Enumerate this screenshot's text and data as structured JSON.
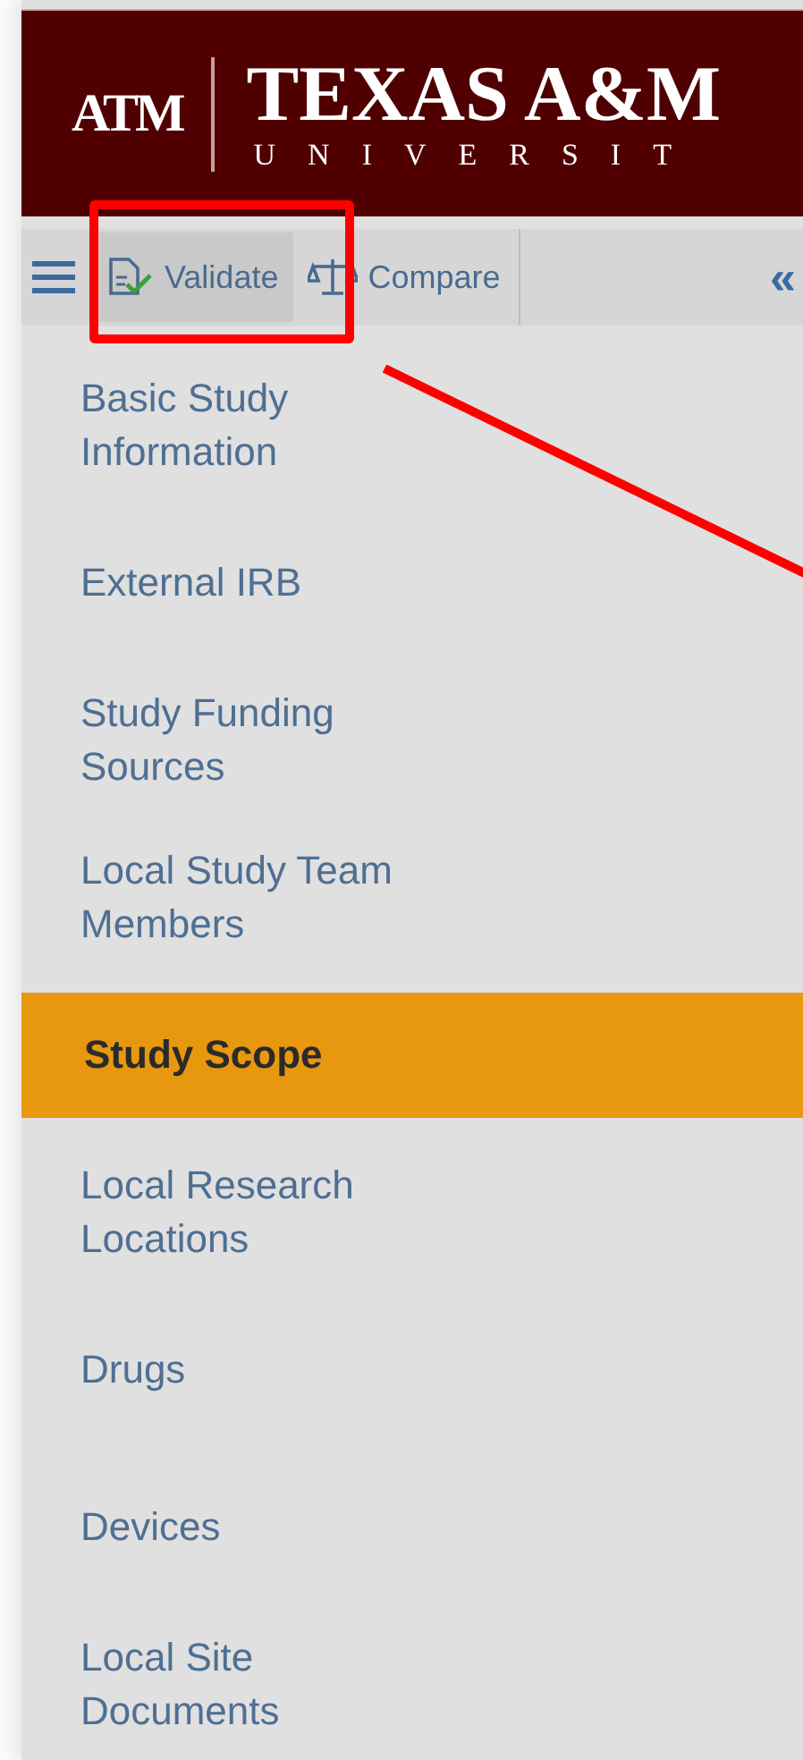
{
  "header": {
    "logo_mark": "ATM",
    "title": "TEXAS A&M",
    "subtitle": "UNIVERSIT"
  },
  "toolbar": {
    "buttons": [
      {
        "kind": "validate",
        "label": "Validate"
      },
      {
        "kind": "compare",
        "label": "Compare"
      }
    ],
    "collapse": "«"
  },
  "sidebar": {
    "items": [
      {
        "label": "Basic Study Information",
        "selected": false
      },
      {
        "label": "External IRB",
        "selected": false
      },
      {
        "label": "Study Funding Sources",
        "selected": false
      },
      {
        "label": "Local Study Team Members",
        "selected": false
      },
      {
        "label": "Study Scope",
        "selected": true
      },
      {
        "label": "Local Research Locations",
        "selected": false
      },
      {
        "label": "Drugs",
        "selected": false
      },
      {
        "label": "Devices",
        "selected": false
      },
      {
        "label": "Local Site Documents",
        "selected": false
      }
    ]
  }
}
